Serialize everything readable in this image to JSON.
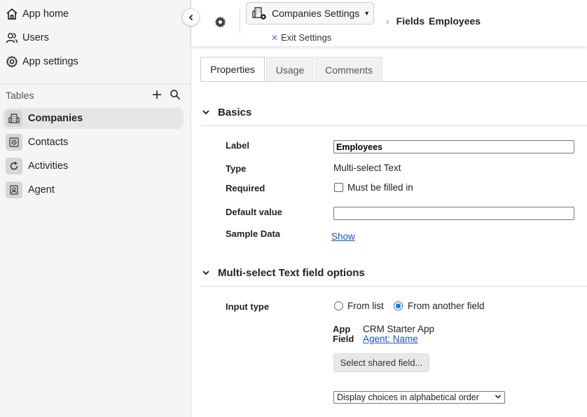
{
  "sidebar": {
    "nav": [
      {
        "label": "App home",
        "icon": "home-icon"
      },
      {
        "label": "Users",
        "icon": "users-icon"
      },
      {
        "label": "App settings",
        "icon": "settings-icon"
      }
    ],
    "tables_heading": "Tables",
    "tables": [
      {
        "label": "Companies",
        "icon": "building-icon",
        "active": true
      },
      {
        "label": "Contacts",
        "icon": "contact-icon",
        "active": false
      },
      {
        "label": "Activities",
        "icon": "refresh-icon",
        "active": false
      },
      {
        "label": "Agent",
        "icon": "badge-icon",
        "active": false
      }
    ]
  },
  "topbar": {
    "settings_dropdown": "Companies Settings",
    "exit_settings": "Exit Settings",
    "breadcrumb": [
      "Fields",
      "Employees"
    ]
  },
  "tabs": [
    {
      "label": "Properties",
      "active": true
    },
    {
      "label": "Usage",
      "active": false
    },
    {
      "label": "Comments",
      "active": false
    }
  ],
  "basics": {
    "title": "Basics",
    "label_label": "Label",
    "label_value": "Employees",
    "type_label": "Type",
    "type_value": "Multi-select Text",
    "required_label": "Required",
    "required_checkbox": "Must be filled in",
    "required_checked": false,
    "default_label": "Default value",
    "default_value": "",
    "sample_label": "Sample Data",
    "sample_link": "Show"
  },
  "options": {
    "title": "Multi-select Text field options",
    "input_type_label": "Input type",
    "radio_list": "From list",
    "radio_field": "From another field",
    "selected": "From another field",
    "app_label": "App",
    "app_value": "CRM Starter App",
    "field_label": "Field",
    "field_value": "Agent: Name",
    "select_shared_button": "Select shared field...",
    "order_select": "Display choices in alphabetical order"
  },
  "colors": {
    "accent": "#1a73e8",
    "link": "#1a55c7",
    "sidebar_bg": "#f5f5f5"
  }
}
